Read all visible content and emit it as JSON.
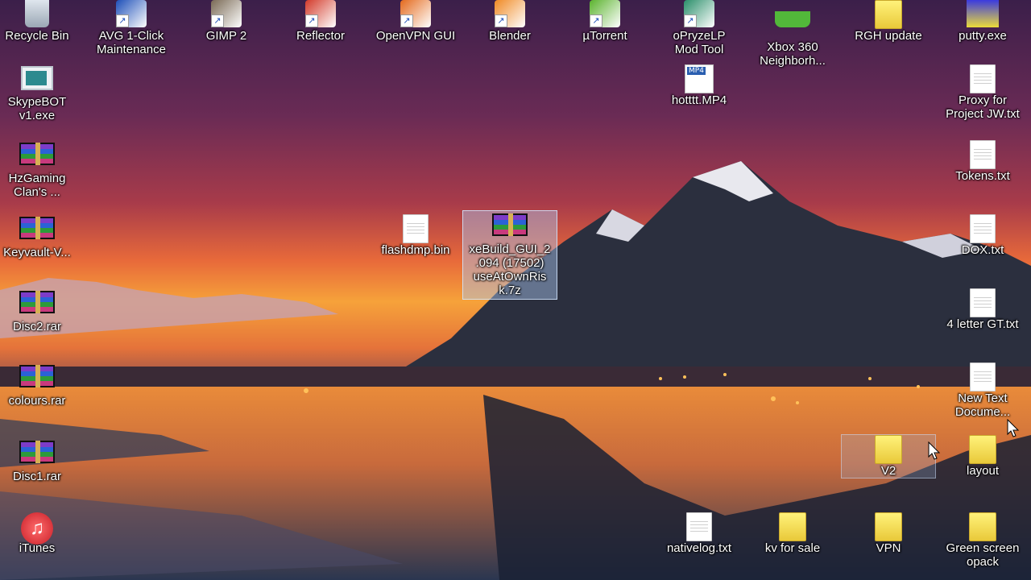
{
  "desktop": {
    "icons": [
      {
        "label": "Recycle Bin",
        "type": "recycle",
        "icon": "recycle-bin-icon"
      },
      {
        "label": "AVG 1-Click\nMaintenance",
        "type": "shortcut",
        "icon": "avg-shield-icon",
        "color": "#1d4fb8"
      },
      {
        "label": "GIMP 2",
        "type": "shortcut",
        "icon": "gimp-icon",
        "color": "#7a6a55"
      },
      {
        "label": "Reflector",
        "type": "shortcut",
        "icon": "reflector-icon",
        "color": "#d33a2a"
      },
      {
        "label": "OpenVPN GUI",
        "type": "shortcut",
        "icon": "openvpn-icon",
        "color": "#e46a1d"
      },
      {
        "label": "Blender",
        "type": "shortcut",
        "icon": "blender-icon",
        "color": "#f08a24"
      },
      {
        "label": "µTorrent",
        "type": "shortcut",
        "icon": "utorrent-icon",
        "color": "#5bb32e"
      },
      {
        "label": "oPryzeLP\nMod Tool",
        "type": "shortcut",
        "icon": "mod-tool-icon",
        "color": "#2a8f6a"
      },
      {
        "label": "Xbox 360\nNeighborh...",
        "type": "xbox",
        "icon": "xbox-icon"
      },
      {
        "label": "RGH update",
        "type": "folder",
        "icon": "folder-icon"
      },
      {
        "label": "putty.exe",
        "type": "putty",
        "icon": "putty-icon"
      },
      {
        "label": "SkypeBOT\nv1.exe",
        "type": "exe",
        "icon": "exe-icon"
      },
      {
        "label": "hotttt.MP4",
        "type": "mp4",
        "icon": "mp4-file-icon"
      },
      {
        "label": "Proxy for\nProject JW.txt",
        "type": "file",
        "icon": "text-file-icon"
      },
      {
        "label": "HzGaming\nClan's     ...",
        "type": "rar",
        "icon": "rar-archive-icon"
      },
      {
        "label": "Tokens.txt",
        "type": "file",
        "icon": "text-file-icon"
      },
      {
        "label": "Keyvault-V...",
        "type": "rar",
        "icon": "rar-archive-icon"
      },
      {
        "label": "flashdmp.bin",
        "type": "file",
        "icon": "file-icon"
      },
      {
        "label": "xeBuild_GUI_2\n.094 (17502)\nuseAtOwnRis\nk.7z",
        "type": "rar",
        "icon": "rar-archive-icon",
        "selected": true
      },
      {
        "label": "DOX.txt",
        "type": "file",
        "icon": "text-file-icon"
      },
      {
        "label": "Disc2.rar",
        "type": "rar",
        "icon": "rar-archive-icon"
      },
      {
        "label": "4 letter GT.txt",
        "type": "file",
        "icon": "text-file-icon"
      },
      {
        "label": "colours.rar",
        "type": "rar",
        "icon": "rar-archive-icon"
      },
      {
        "label": "New Text\nDocume...",
        "type": "file",
        "icon": "text-file-icon"
      },
      {
        "label": "Disc1.rar",
        "type": "rar",
        "icon": "rar-archive-icon"
      },
      {
        "label": "V2",
        "type": "folder",
        "icon": "folder-icon",
        "hover": true
      },
      {
        "label": "layout",
        "type": "folder",
        "icon": "folder-icon"
      },
      {
        "label": "iTunes",
        "type": "itunes",
        "icon": "itunes-icon"
      },
      {
        "label": "nativelog.txt",
        "type": "file",
        "icon": "text-file-icon"
      },
      {
        "label": "kv for sale",
        "type": "folder",
        "icon": "folder-icon"
      },
      {
        "label": "VPN",
        "type": "folder",
        "icon": "folder-icon"
      },
      {
        "label": "Green screen\nopack",
        "type": "folder",
        "icon": "folder-icon"
      }
    ]
  }
}
